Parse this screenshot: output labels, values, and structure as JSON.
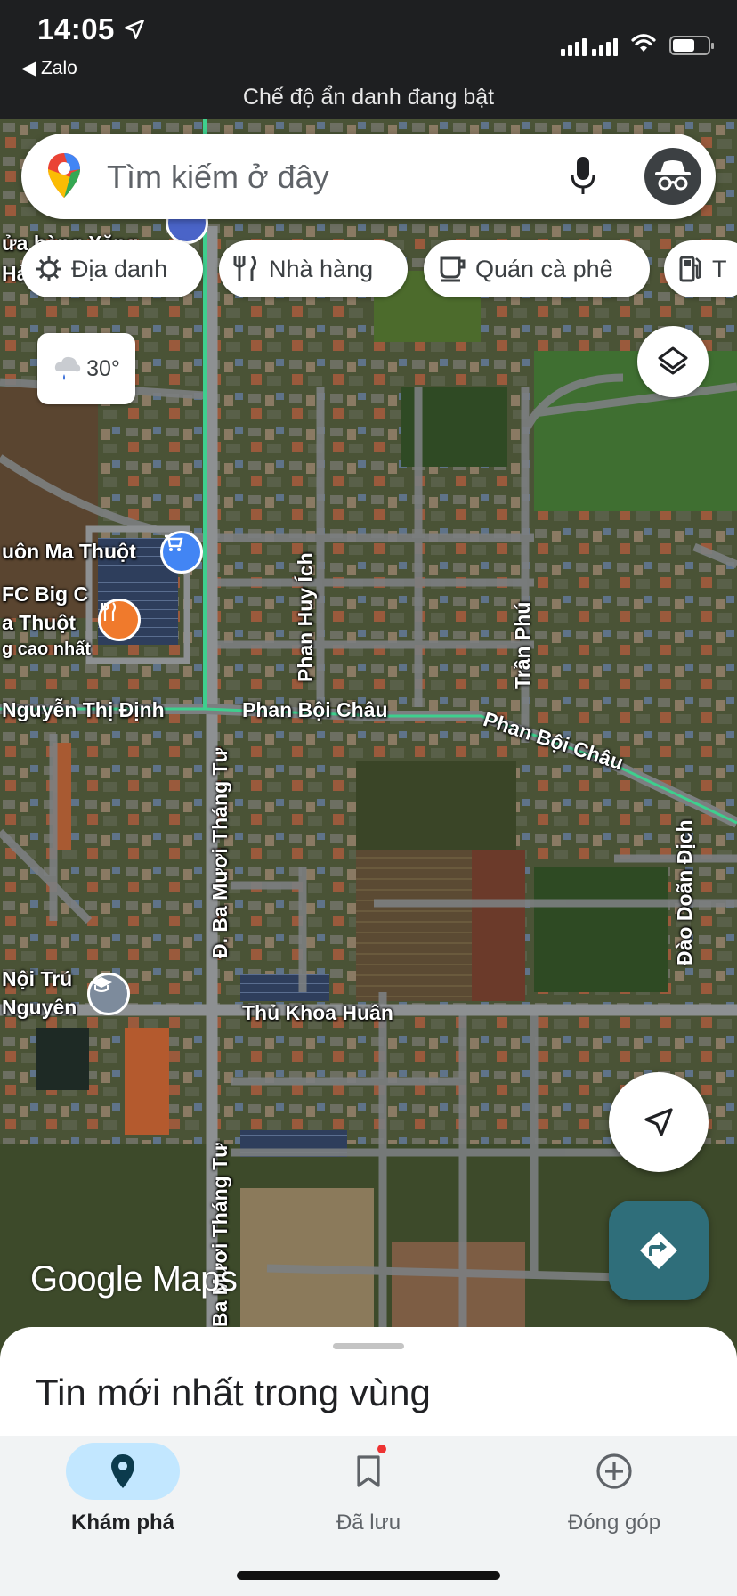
{
  "status_bar": {
    "time": "14:05",
    "location_icon": "location-arrow-icon",
    "back_app": "◀ Zalo",
    "banner": "Chế độ ẩn danh đang bật"
  },
  "search": {
    "placeholder": "Tìm kiếm ở đây",
    "mic_icon": "mic-icon",
    "avatar_icon": "incognito-icon"
  },
  "chips": [
    {
      "label": "Địa danh",
      "icon": "landmark-icon"
    },
    {
      "label": "Nhà hàng",
      "icon": "restaurant-icon"
    },
    {
      "label": "Quán cà phê",
      "icon": "coffee-icon"
    },
    {
      "label": "T",
      "icon": "gas-station-icon"
    }
  ],
  "weather": {
    "temp": "30°",
    "icon": "rain-cloud-icon"
  },
  "map_labels": {
    "road_nguyen_thi_dinh": "Nguyễn Thị Định",
    "road_phan_boi_chau_1": "Phan Bội Châu",
    "road_phan_boi_chau_2": "Phan Bội Châu",
    "road_phan_huy_ich": "Phan Huy Ích",
    "road_tran_phu": "Trần Phú",
    "road_ba_muoi_thang_tu_1": "Đ. Ba Mươi Tháng Tư",
    "road_ba_muoi_thang_tu_2": "Ba Mươi Tháng Tư",
    "road_dao_doan_dich": "Đào Doãn Địch",
    "road_thu_khoa_huan": "Thủ Khoa Huân",
    "poi_buon_ma_thuot": "uôn Ma Thuột",
    "poi_kfc_1": "FC Big C",
    "poi_kfc_2": "a Thuột",
    "poi_kfc_3": "g cao nhất",
    "poi_store_1": "ửa hàng Xăng",
    "poi_store_2": "Hả",
    "poi_school_1": "Nội Trú",
    "poi_school_2": "Nguyên"
  },
  "map_logo": "Google Maps",
  "sheet": {
    "title": "Tin mới nhất trong vùng"
  },
  "nav": [
    {
      "label": "Khám phá",
      "icon": "explore-pin-icon",
      "active": true
    },
    {
      "label": "Đã lưu",
      "icon": "bookmark-icon",
      "active": false
    },
    {
      "label": "Đóng góp",
      "icon": "add-circle-icon",
      "active": false
    }
  ],
  "colors": {
    "accent_teal": "#2f6e7a",
    "nav_active_bg": "#c2e7ff",
    "road_green": "#3ecf8e",
    "map_satellite": "#3b4a2c"
  }
}
